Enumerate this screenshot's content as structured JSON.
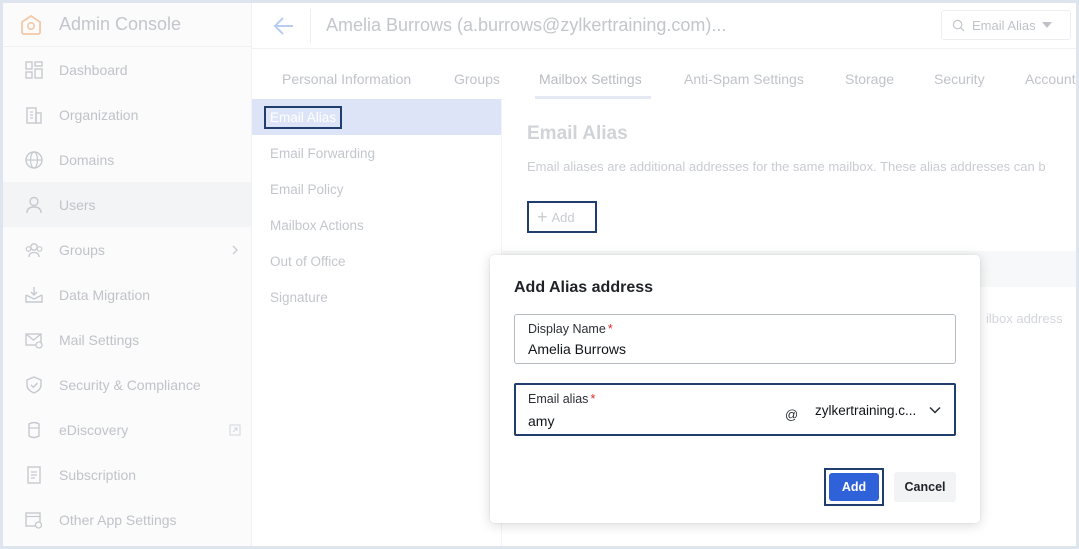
{
  "app": {
    "title": "Admin Console"
  },
  "sidebar": {
    "items": [
      {
        "label": "Dashboard",
        "icon": "dashboard-icon"
      },
      {
        "label": "Organization",
        "icon": "organization-icon"
      },
      {
        "label": "Domains",
        "icon": "globe-icon"
      },
      {
        "label": "Users",
        "icon": "user-icon",
        "active": true
      },
      {
        "label": "Groups",
        "icon": "groups-icon",
        "has_submenu": true
      },
      {
        "label": "Data Migration",
        "icon": "data-migration-icon"
      },
      {
        "label": "Mail Settings",
        "icon": "mail-settings-icon"
      },
      {
        "label": "Security & Compliance",
        "icon": "shield-icon"
      },
      {
        "label": "eDiscovery",
        "icon": "ediscovery-icon",
        "external": true
      },
      {
        "label": "Subscription",
        "icon": "subscription-icon"
      },
      {
        "label": "Other App Settings",
        "icon": "app-settings-icon"
      }
    ]
  },
  "header": {
    "user_title": "Amelia Burrows (a.burrows@zylkertraining.com)...",
    "search_label": "Email Alias"
  },
  "tabs": [
    {
      "label": "Personal Information"
    },
    {
      "label": "Groups"
    },
    {
      "label": "Mailbox Settings",
      "active": true
    },
    {
      "label": "Anti-Spam Settings"
    },
    {
      "label": "Storage"
    },
    {
      "label": "Security"
    },
    {
      "label": "Account"
    }
  ],
  "submenu": {
    "items": [
      {
        "label": "Email Alias",
        "active": true
      },
      {
        "label": "Email Forwarding"
      },
      {
        "label": "Email Policy"
      },
      {
        "label": "Mailbox Actions"
      },
      {
        "label": "Out of Office"
      },
      {
        "label": "Signature"
      }
    ]
  },
  "content": {
    "title": "Email Alias",
    "description": "Email aliases are additional addresses for the same mailbox. These alias addresses can b",
    "add_label": "Add",
    "table_partial": "ilbox address"
  },
  "modal": {
    "title": "Add Alias address",
    "display_name_label": "Display Name",
    "display_name_value": "Amelia Burrows",
    "email_alias_label": "Email alias",
    "email_alias_value": "amy",
    "at_symbol": "@",
    "domain_value": "zylkertraining.c...",
    "add_button": "Add",
    "cancel_button": "Cancel"
  },
  "colors": {
    "accent": "#2f62d8",
    "highlight_border": "#1f3e6e",
    "required": "#d62b2b"
  }
}
